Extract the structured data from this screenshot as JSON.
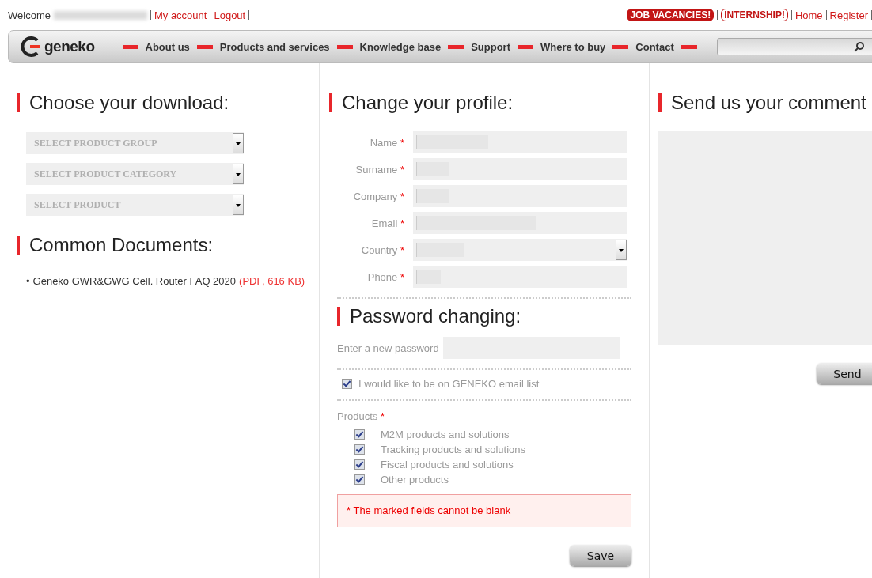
{
  "top_bar": {
    "welcome": "Welcome",
    "links": [
      {
        "label": "My account"
      },
      {
        "label": "Logout"
      }
    ],
    "badges": [
      {
        "label": "JOB VACANCIES!",
        "kind": "filled"
      },
      {
        "label": "INTERNSHIP!",
        "kind": "outlined"
      }
    ],
    "right_links": [
      {
        "label": "Home"
      },
      {
        "label": "Register"
      }
    ]
  },
  "nav": {
    "logo": "geneko",
    "items": [
      {
        "label": "About us"
      },
      {
        "label": "Products and services"
      },
      {
        "label": "Knowledge base"
      },
      {
        "label": "Support"
      },
      {
        "label": "Where to buy"
      },
      {
        "label": "Contact"
      }
    ]
  },
  "download": {
    "title": "Choose your download:",
    "selects": [
      {
        "placeholder": "SELECT PRODUCT GROUP"
      },
      {
        "placeholder": "SELECT PRODUCT CATEGORY"
      },
      {
        "placeholder": "SELECT PRODUCT"
      }
    ]
  },
  "documents": {
    "title": "Common Documents:",
    "items": [
      {
        "bullet": "•",
        "name": "Geneko GWR&GWG Cell. Router FAQ 2020",
        "link": "(PDF, 616 KB)"
      }
    ]
  },
  "profile": {
    "title": "Change your profile:",
    "fields": [
      {
        "label": "Name",
        "mark": "*",
        "kind": "text"
      },
      {
        "label": "Surname",
        "mark": "*",
        "kind": "text"
      },
      {
        "label": "Company",
        "mark": "*",
        "kind": "text"
      },
      {
        "label": "Email",
        "mark": "*",
        "kind": "text"
      },
      {
        "label": "Country",
        "mark": "*",
        "kind": "select"
      },
      {
        "label": "Phone",
        "mark": "*",
        "kind": "text"
      }
    ]
  },
  "password": {
    "title": "Password changing:",
    "label": "Enter a new password"
  },
  "newsletter": {
    "label": "I would like to be on GENEKO email list",
    "checked": true
  },
  "products": {
    "label": "Products",
    "mark": "*",
    "items": [
      {
        "label": "M2M products and solutions",
        "checked": true
      },
      {
        "label": "Tracking products and solutions",
        "checked": true
      },
      {
        "label": "Fiscal products and solutions",
        "checked": true
      },
      {
        "label": "Other products",
        "checked": true
      }
    ]
  },
  "error": "* The marked fields cannot be blank",
  "save": "Save",
  "comment": {
    "title": "Send us your comment",
    "button": "Send"
  }
}
